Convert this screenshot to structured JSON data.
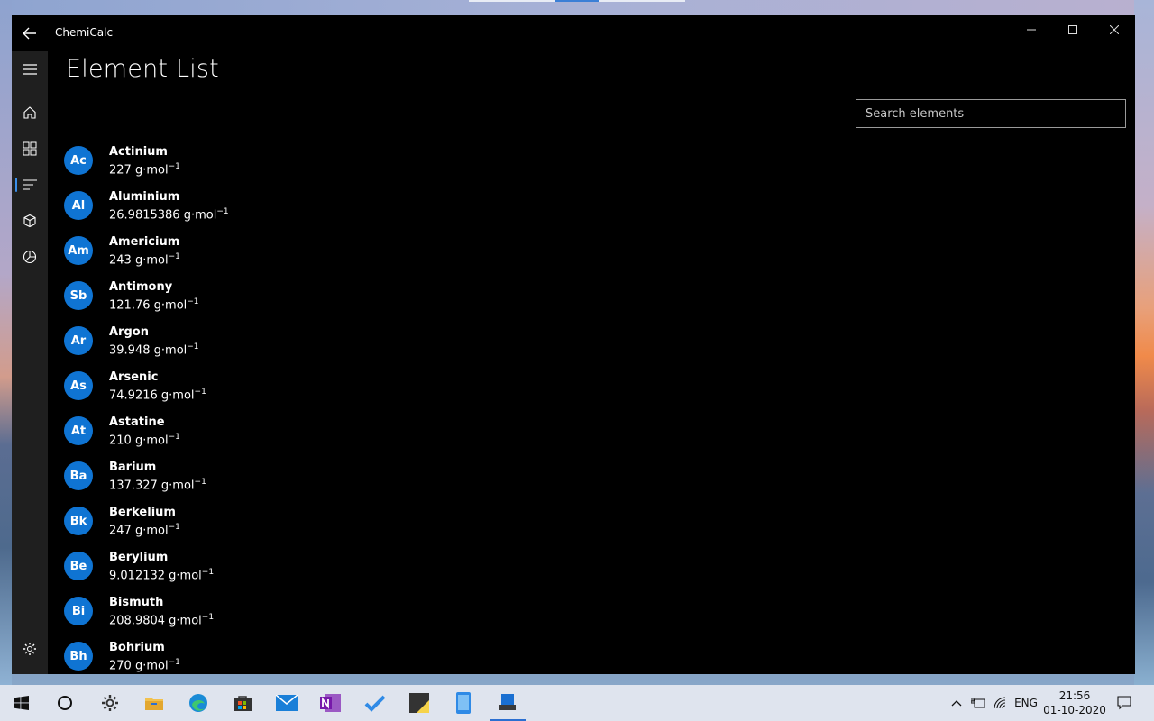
{
  "window": {
    "app_title": "ChemiCalc",
    "page_title": "Element List"
  },
  "search": {
    "placeholder": "Search elements",
    "value": ""
  },
  "nav": {
    "items": [
      {
        "icon": "hamburger-menu-icon"
      },
      {
        "icon": "home-icon"
      },
      {
        "icon": "grid-icon"
      },
      {
        "icon": "list-icon",
        "selected": true
      },
      {
        "icon": "cube-icon"
      },
      {
        "icon": "pie-chart-icon"
      },
      {
        "icon": "gear-icon"
      }
    ]
  },
  "mass_unit": "g·mol",
  "mass_exponent": "−1",
  "elements": [
    {
      "symbol": "Ac",
      "name": "Actinium",
      "mass": "227"
    },
    {
      "symbol": "Al",
      "name": "Aluminium",
      "mass": "26.9815386"
    },
    {
      "symbol": "Am",
      "name": "Americium",
      "mass": "243"
    },
    {
      "symbol": "Sb",
      "name": "Antimony",
      "mass": "121.76"
    },
    {
      "symbol": "Ar",
      "name": "Argon",
      "mass": "39.948"
    },
    {
      "symbol": "As",
      "name": "Arsenic",
      "mass": "74.9216"
    },
    {
      "symbol": "At",
      "name": "Astatine",
      "mass": "210"
    },
    {
      "symbol": "Ba",
      "name": "Barium",
      "mass": "137.327"
    },
    {
      "symbol": "Bk",
      "name": "Berkelium",
      "mass": "247"
    },
    {
      "symbol": "Be",
      "name": "Berylium",
      "mass": "9.012132"
    },
    {
      "symbol": "Bi",
      "name": "Bismuth",
      "mass": "208.9804"
    },
    {
      "symbol": "Bh",
      "name": "Bohrium",
      "mass": "270"
    }
  ],
  "colors": {
    "accent": "#0f74d3",
    "window_bg": "#000000",
    "nav_bg": "#1f1f1f",
    "taskbar_bg": "#dfe4ee"
  },
  "taskbar": {
    "apps": [
      "windows-start-icon",
      "cortana-icon",
      "settings-icon",
      "file-explorer-icon",
      "edge-icon",
      "store-icon",
      "mail-icon",
      "onenote-icon",
      "todo-icon",
      "sticky-notes-icon",
      "phone-icon",
      "chemicalc-icon"
    ],
    "language": "ENG",
    "time": "21:56",
    "date": "01-10-2020"
  }
}
